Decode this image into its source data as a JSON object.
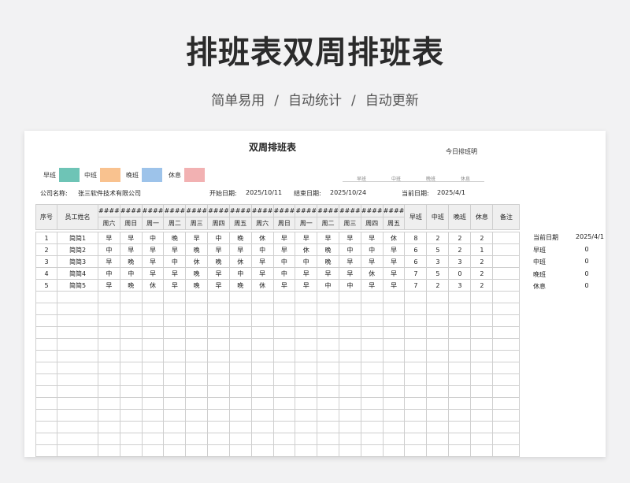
{
  "hero": {
    "title": "排班表双周排班表",
    "tags": [
      "简单易用",
      "自动统计",
      "自动更新"
    ],
    "separator": "/"
  },
  "sheet": {
    "title": "双周排班表",
    "today_label": "今日排班明",
    "legend": [
      {
        "label": "早班",
        "color": "#6ec4b6"
      },
      {
        "label": "中班",
        "color": "#f9c28f"
      },
      {
        "label": "晚班",
        "color": "#9dc3ea"
      },
      {
        "label": "休息",
        "color": "#f2b1b2"
      }
    ],
    "hints": [
      "早班",
      "中班",
      "晚班",
      "休息"
    ],
    "company_label": "公司名称:",
    "company": "张三软件技术有限公司",
    "start_label": "开始日期:",
    "start_date": "2025/10/11",
    "end_label": "结束日期:",
    "end_date": "2025/10/24",
    "current_label": "当前日期:",
    "current_date": "2025/4/1"
  },
  "table": {
    "col_seq": "序号",
    "col_name": "员工姓名",
    "date_placeholder": "####",
    "weekdays": [
      "周六",
      "周日",
      "周一",
      "周二",
      "周三",
      "周四",
      "周五",
      "周六",
      "周日",
      "周一",
      "周二",
      "周三",
      "周四",
      "周五"
    ],
    "stat_headers": [
      "早班",
      "中班",
      "晚班",
      "休息",
      "备注"
    ],
    "rows": [
      {
        "seq": "1",
        "name": "简简1",
        "shifts": [
          "早",
          "早",
          "中",
          "晚",
          "早",
          "中",
          "晚",
          "休",
          "早",
          "早",
          "早",
          "早",
          "早",
          "休"
        ],
        "stats": [
          "8",
          "2",
          "2",
          "2"
        ]
      },
      {
        "seq": "2",
        "name": "简简2",
        "shifts": [
          "中",
          "早",
          "早",
          "早",
          "晚",
          "早",
          "早",
          "中",
          "早",
          "休",
          "晚",
          "中",
          "中",
          "早"
        ],
        "stats": [
          "6",
          "5",
          "2",
          "1"
        ]
      },
      {
        "seq": "3",
        "name": "简简3",
        "shifts": [
          "早",
          "晚",
          "早",
          "中",
          "休",
          "晚",
          "休",
          "早",
          "中",
          "中",
          "晚",
          "早",
          "早",
          "早"
        ],
        "stats": [
          "6",
          "3",
          "3",
          "2"
        ]
      },
      {
        "seq": "4",
        "name": "简简4",
        "shifts": [
          "中",
          "中",
          "早",
          "早",
          "晚",
          "早",
          "中",
          "早",
          "中",
          "早",
          "早",
          "早",
          "休",
          "早"
        ],
        "stats": [
          "7",
          "5",
          "0",
          "2"
        ]
      },
      {
        "seq": "5",
        "name": "简简5",
        "shifts": [
          "早",
          "晚",
          "休",
          "早",
          "晚",
          "早",
          "晚",
          "休",
          "早",
          "早",
          "中",
          "中",
          "早",
          "早"
        ],
        "stats": [
          "7",
          "2",
          "3",
          "2"
        ]
      }
    ],
    "empty_rows": 14
  },
  "summary": {
    "date_label": "当前日期",
    "date_value": "2025/4/1",
    "items": [
      {
        "label": "早班",
        "value": "0"
      },
      {
        "label": "中班",
        "value": "0"
      },
      {
        "label": "晚班",
        "value": "0"
      },
      {
        "label": "休息",
        "value": "0"
      }
    ]
  }
}
